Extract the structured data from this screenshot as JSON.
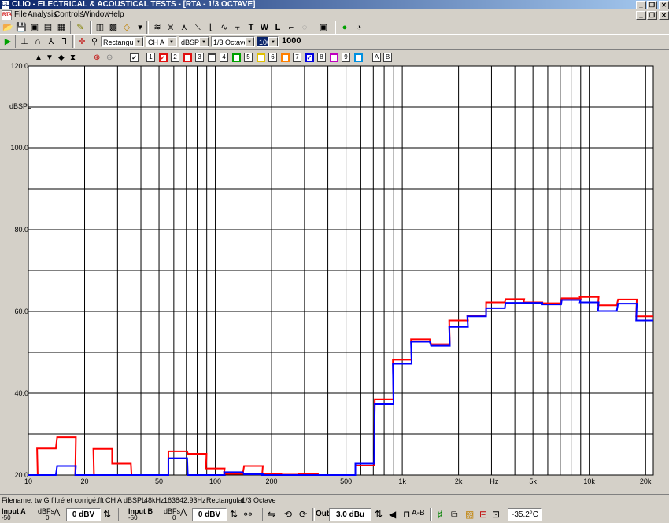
{
  "window": {
    "app_icon": "CLIO",
    "title": "CLIO - ELECTRICAL & ACOUSTICAL TESTS - [RTA - 1/3 OCTAVE]",
    "controls": [
      "_",
      "❐",
      "✕"
    ]
  },
  "menu": {
    "items": [
      "File",
      "Analysis",
      "Controls",
      "Window",
      "Help"
    ],
    "doc_controls": [
      "_",
      "❐",
      "✕"
    ]
  },
  "toolbar1": {
    "icons": [
      "open-icon",
      "save-icon",
      "print-icon",
      "copy-icon",
      "notes-icon",
      "calibrate-icon",
      "camera-icon",
      "settings-icon",
      "eraser-icon",
      "mls-icon",
      "fft-icon",
      "sinusoidal-icon",
      "waterfall-icon",
      "decay-icon",
      "sweep-icon",
      "ts-icon",
      "wow-icon",
      "leq-icon",
      "step-icon",
      "qc-icon",
      "multimeter-icon",
      "help-icon",
      "about-icon"
    ]
  },
  "toolbar2": {
    "window_type": "Rectangular",
    "channel": "CH A",
    "units": "dBSPL",
    "octave": "1/3 Octave",
    "freq_select": "1000",
    "freq_value": "1000"
  },
  "graph_toolbar": {
    "overlay_numbers": [
      "1",
      "2",
      "3",
      "4",
      "5",
      "6",
      "7",
      "8",
      "9"
    ],
    "overlay_checked": [
      true,
      false,
      false,
      false,
      false,
      false,
      true,
      false,
      false
    ],
    "overlay_colors": [
      "#e01010",
      "#e01010",
      "#404040",
      "#00a000",
      "#e0c000",
      "#ff8000",
      "#0000e0",
      "#c000c0",
      "#0090e0"
    ],
    "ab_labels": [
      "A",
      "B"
    ]
  },
  "chart_data": {
    "type": "line",
    "title": "",
    "ylabel": "dBSPL",
    "xlabel": "Hz",
    "ylim": [
      20,
      120
    ],
    "xlim": [
      10,
      22000
    ],
    "x_scale": "log",
    "grid": true,
    "y_ticks": [
      "120.0",
      "100.0",
      "80.0",
      "60.0",
      "40.0",
      "20.0"
    ],
    "x_ticks": [
      "10",
      "20",
      "50",
      "100",
      "200",
      "500",
      "1k",
      "2k",
      "5k",
      "10k",
      "20k"
    ],
    "x_unit_label": "Hz",
    "bands": [
      10,
      12.5,
      16,
      20,
      25,
      31.5,
      40,
      50,
      63,
      80,
      100,
      125,
      160,
      200,
      250,
      315,
      400,
      500,
      630,
      800,
      1000,
      1250,
      1600,
      2000,
      2500,
      3150,
      4000,
      5000,
      6300,
      8000,
      10000,
      12500,
      16000,
      20000
    ],
    "series": [
      {
        "name": "1",
        "color": "#ff0000",
        "values": [
          20,
          26.5,
          29.2,
          20,
          26.4,
          22.8,
          20,
          20,
          25.8,
          25.2,
          21.6,
          20.3,
          22.2,
          20.3,
          20.1,
          20.3,
          20,
          20,
          22.3,
          38.5,
          48.2,
          53.2,
          52,
          57.8,
          59,
          62.2,
          63,
          62.2,
          62,
          63.2,
          63.5,
          61.5,
          62.9,
          58.8
        ]
      },
      {
        "name": "7",
        "color": "#0000ff",
        "values": [
          20,
          20,
          22.2,
          20,
          20,
          20,
          20,
          20,
          24.1,
          20,
          20,
          20.7,
          20.2,
          20,
          20,
          20,
          20,
          20,
          22.8,
          37.3,
          47.2,
          52.6,
          51.6,
          56.2,
          58.8,
          60.8,
          62.1,
          62.1,
          61.7,
          62.8,
          62.2,
          60.1,
          61.9,
          57.8
        ]
      }
    ]
  },
  "status": {
    "filename": "Filename: tw G filtré et corrigé.fft",
    "channel": "CH A",
    "units": "dBSPL",
    "rate": "48kHz",
    "size": "16384",
    "resolution": "2.93Hz",
    "window": "Rectangular",
    "octave": "1/3 Octave"
  },
  "bottom": {
    "input_a_label": "Input A",
    "input_a_range": "-50",
    "dbfs_a_label": "dBFs",
    "dbfs_a_value": "0",
    "input_a_value": "0 dBV",
    "input_b_label": "Input B",
    "input_b_range": "-50",
    "dbfs_b_label": "dBFs",
    "dbfs_b_value": "0",
    "input_b_value": "0 dBV",
    "ab_label": "A-B",
    "out_label": "Out",
    "out_value": "3.0 dBu",
    "temperature": "-35.2°C"
  }
}
